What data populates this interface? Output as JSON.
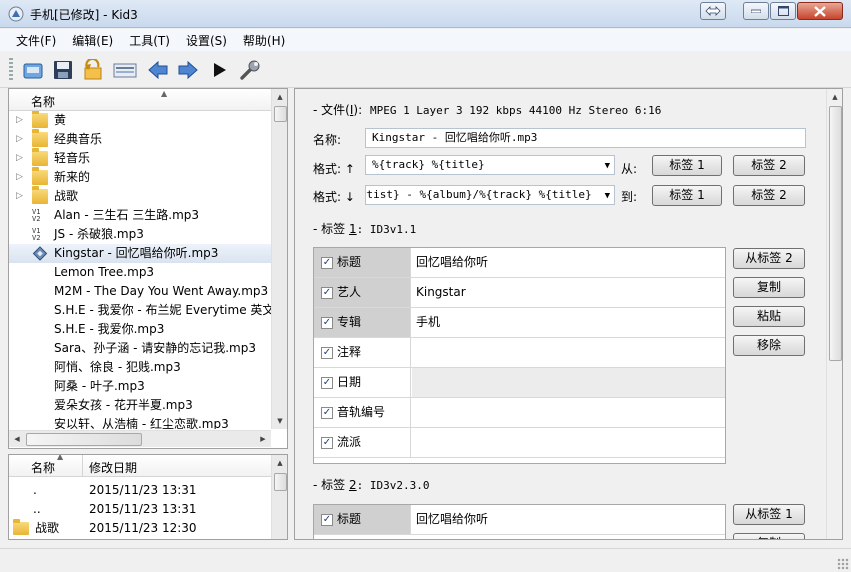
{
  "window": {
    "title": "手机[已修改] - Kid3"
  },
  "menu": [
    "文件(F)",
    "编辑(E)",
    "工具(T)",
    "设置(S)",
    "帮助(H)"
  ],
  "toolbar": [
    {
      "name": "open-icon"
    },
    {
      "name": "save-icon"
    },
    {
      "name": "revert-icon"
    },
    {
      "name": "playlist-icon"
    },
    {
      "name": "previous-icon"
    },
    {
      "name": "next-icon"
    },
    {
      "name": "play-icon"
    },
    {
      "name": "settings-wrench-icon"
    }
  ],
  "tree": {
    "header": "名称",
    "rows": [
      {
        "label": "黄",
        "type": "folder"
      },
      {
        "label": "经典音乐",
        "type": "folder"
      },
      {
        "label": "轻音乐",
        "type": "folder"
      },
      {
        "label": "新来的",
        "type": "folder"
      },
      {
        "label": "战歌",
        "type": "folder"
      },
      {
        "label": "Alan - 三生石 三生路.mp3",
        "type": "v12"
      },
      {
        "label": "JS - 杀破狼.mp3",
        "type": "v12"
      },
      {
        "label": "Kingstar - 回忆唱给你听.mp3",
        "type": "modified",
        "selected": true
      },
      {
        "label": "Lemon Tree.mp3",
        "type": "file"
      },
      {
        "label": "M2M - The Day You Went Away.mp3",
        "type": "file"
      },
      {
        "label": "S.H.E - 我爱你 - 布兰妮 Everytime 英文",
        "type": "file"
      },
      {
        "label": "S.H.E - 我爱你.mp3",
        "type": "file"
      },
      {
        "label": "Sara、孙子涵 - 请安静的忘记我.mp3",
        "type": "file"
      },
      {
        "label": "阿悄、徐良 - 犯贱.mp3",
        "type": "file"
      },
      {
        "label": "阿桑 - 叶子.mp3",
        "type": "file"
      },
      {
        "label": "爱朵女孩 - 花开半夏.mp3",
        "type": "file"
      },
      {
        "label": "安以轩、从浩楠 - 红尘恋歌.mp3",
        "type": "file"
      }
    ]
  },
  "file_list": {
    "col_name": "名称",
    "col_date": "修改日期",
    "rows": [
      {
        "name": ".",
        "date": "2015/11/23 13:31",
        "folder": false
      },
      {
        "name": "..",
        "date": "2015/11/23 13:31",
        "folder": false
      },
      {
        "name": "战歌",
        "date": "2015/11/23 12:30",
        "folder": true
      }
    ]
  },
  "file_section": {
    "prefix": "文件(",
    "accel": "I",
    "suffix": "):",
    "info": "MPEG 1 Layer 3 192 kbps 44100 Hz Stereo 6:16",
    "name_label": "名称:",
    "name_value": "Kingstar - 回忆唱给你听.mp3",
    "format_from_label": "格式: ↑",
    "format_from_value": "%{track} %{title}",
    "from_label": "从:",
    "format_to_label": "格式: ↓",
    "format_to_value": "%{artist} - %{album}/%{track} %{title}",
    "to_label": "到:",
    "tag1_btn": "标签 1",
    "tag2_btn": "标签 2"
  },
  "tag1": {
    "prefix": "标签 ",
    "accel": "1",
    "suffix": ": ID3v1.1",
    "rows": [
      {
        "name": "标题",
        "value": "回忆唱给你听"
      },
      {
        "name": "艺人",
        "value": "Kingstar"
      },
      {
        "name": "专辑",
        "value": "手机"
      },
      {
        "name": "注释",
        "value": ""
      },
      {
        "name": "日期",
        "value": ""
      },
      {
        "name": "音轨编号",
        "value": ""
      },
      {
        "name": "流派",
        "value": ""
      }
    ],
    "buttons": [
      "从标签 2",
      "复制",
      "粘贴",
      "移除"
    ]
  },
  "tag2": {
    "prefix": "标签 ",
    "accel": "2",
    "suffix": ": ID3v2.3.0",
    "rows": [
      {
        "name": "标题",
        "value": "回忆唱给你听"
      }
    ],
    "buttons": [
      "从标签 1",
      "复制"
    ]
  },
  "colors": {
    "accent_arrow": "#2a6fc9",
    "selection": "#d9e3f0",
    "folder": "#e8b535"
  }
}
